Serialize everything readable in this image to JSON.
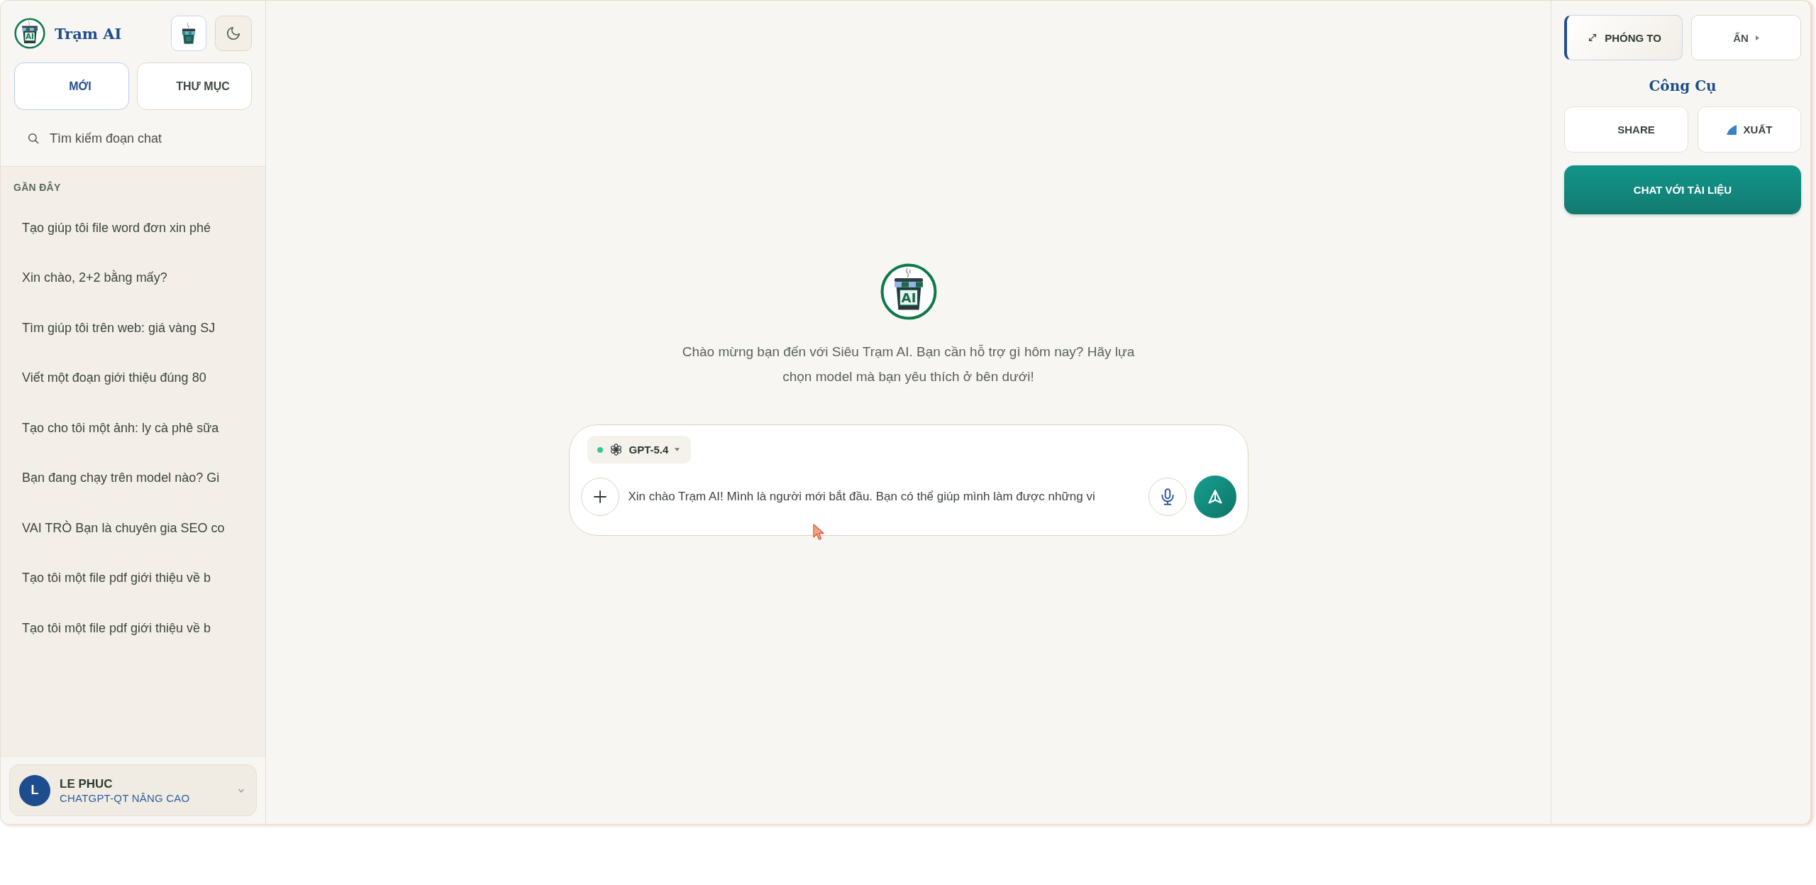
{
  "sidebar": {
    "brand": {
      "name": "Trạm AI",
      "badge": "AI"
    },
    "buttons": [
      {
        "label": "MỚI",
        "kind": "primary"
      },
      {
        "label": "THƯ MỤC",
        "kind": "secondary"
      }
    ],
    "search": {
      "label": "Tìm kiếm đoạn chat"
    },
    "recent": {
      "heading": "GẦN ĐÂY",
      "items": [
        {
          "title": "Tạo giúp tôi file word đơn xin phé",
          "selected": false
        },
        {
          "title": "Xin chào, 2+2 bằng mấy?",
          "selected": false
        },
        {
          "title": "Tìm giúp tôi trên web: giá vàng SJ",
          "selected": false
        },
        {
          "title": "Viết một đoạn giới thiệu đúng 80",
          "selected": false
        },
        {
          "title": "Tạo cho tôi một ảnh: ly cà phê sữa",
          "selected": false
        },
        {
          "title": "Bạn đang chạy trên model nào? Gi",
          "selected": false
        },
        {
          "title": "VAI TRÒ Bạn là chuyên gia SEO co",
          "selected": false
        },
        {
          "title": "Tạo tôi một file pdf giới thiệu về b",
          "selected": false
        },
        {
          "title": "Tạo tôi một file pdf giới thiệu về b",
          "selected": false
        }
      ]
    },
    "user": {
      "initial": "L",
      "name": "LE PHUC",
      "plan": "CHATGPT-QT NÂNG CAO"
    }
  },
  "main": {
    "logo_badge": "AI",
    "welcome": "Chào mừng bạn đến với Siêu Trạm AI. Bạn cần hỗ trợ gì hôm nay? Hãy lựa chọn model mà bạn yêu thích ở bên dưới!",
    "composer": {
      "model": {
        "name": "GPT-5.4",
        "available": true
      },
      "value": "Xin chào Trạm AI! Mình là người mới bắt đầu. Bạn có thể giúp mình làm được những vi"
    }
  },
  "tools_panel": {
    "view_buttons": [
      {
        "label": "PHÓNG TO",
        "kind": "expand",
        "selected": true
      },
      {
        "label": "ẨN",
        "kind": "hide",
        "selected": false
      }
    ],
    "title": "Công Cụ",
    "actions": [
      {
        "label": "SHARE",
        "kind": "share"
      },
      {
        "label": "XUẤT",
        "kind": "export"
      }
    ],
    "primary_action": {
      "label": "CHAT VỚI TÀI LIỆU"
    }
  }
}
